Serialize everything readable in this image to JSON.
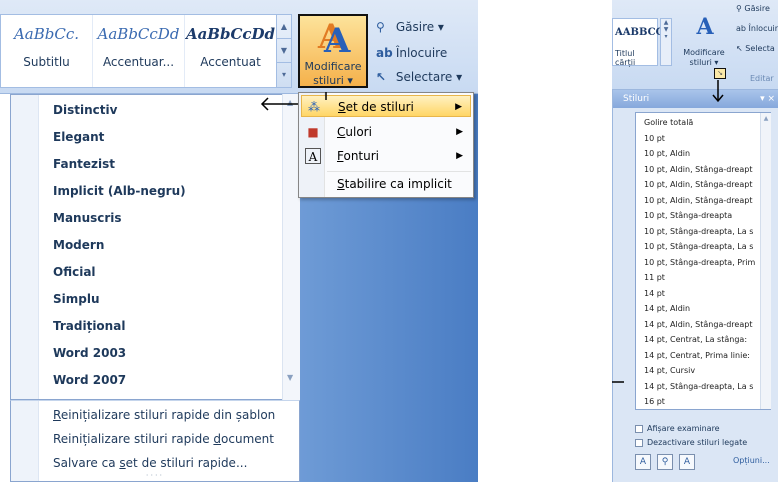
{
  "ribbon": {
    "gallery": [
      {
        "sample": "AaBbCc.",
        "name": "Subtitlu",
        "bold": false
      },
      {
        "sample": "AaBbCcDd",
        "name": "Accentuar...",
        "bold": false
      },
      {
        "sample": "AaBbCcDd",
        "name": "Accentuat",
        "bold": true
      }
    ],
    "modify_styles": {
      "line1": "Modificare",
      "line2": "stiluri ▾"
    },
    "find": "Găsire ▾",
    "replace": "Înlocuire",
    "select": "Selectare ▾"
  },
  "style_sets": [
    "Distinctiv",
    "Elegant",
    "Fantezist",
    "Implicit (Alb-negru)",
    "Manuscris",
    "Modern",
    "Oficial",
    "Simplu",
    "Tradițional",
    "Word 2003",
    "Word 2007"
  ],
  "actions": [
    {
      "pre": "",
      "key": "R",
      "post": "einițializare stiluri rapide din șablon"
    },
    {
      "pre": "Reinițializare stiluri rapide ",
      "key": "d",
      "post": "ocument"
    },
    {
      "pre": "Salvare ca ",
      "key": "s",
      "post": "et de stiluri rapide..."
    }
  ],
  "submenu": [
    {
      "key": "S",
      "post": "et de stiluri",
      "arrow": true,
      "highlight": true,
      "icon": "style-set-icon"
    },
    {
      "key": "C",
      "post": "ulori",
      "arrow": true,
      "highlight": false,
      "icon": "colors-icon"
    },
    {
      "key": "F",
      "post": "onturi",
      "arrow": true,
      "highlight": false,
      "icon": "fonts-icon"
    },
    {
      "key": "S",
      "post": "tabilire ca implicit",
      "arrow": false,
      "highlight": false,
      "icon": ""
    }
  ],
  "right_ribbon": {
    "gallery_sample": "AABBCC",
    "gallery_name": "Titlul cărții",
    "modify_line1": "Modificare",
    "modify_line2": "stiluri ▾",
    "find": "Găsire",
    "replace": "Înlocuir",
    "select": "Selecta",
    "group": "Editar"
  },
  "styles_pane": {
    "title": "Stiluri",
    "close": "▾ ×",
    "items": [
      "Golire totală",
      "10 pt",
      "10 pt, Aldin",
      "10 pt, Aldin, Stânga-dreapt",
      "10 pt, Aldin, Stânga-dreapt",
      "10 pt, Aldin, Stânga-dreapt",
      "10 pt, Stânga-dreapta",
      "10 pt, Stânga-dreapta, La s",
      "10 pt, Stânga-dreapta, La s",
      "10 pt, Stânga-dreapta, Prim",
      "11 pt",
      "14 pt",
      "14 pt, Aldin",
      "14 pt, Aldin, Stânga-dreapt",
      "14 pt, Centrat, La stânga:",
      "14 pt, Centrat, Prima linie:",
      "14 pt, Cursiv",
      "14 pt, Stânga-dreapta, La s",
      "16 pt"
    ],
    "show_preview": "Afișare examinare",
    "disable_linked": "Dezactivare stiluri legate",
    "options": "Opțiuni..."
  }
}
